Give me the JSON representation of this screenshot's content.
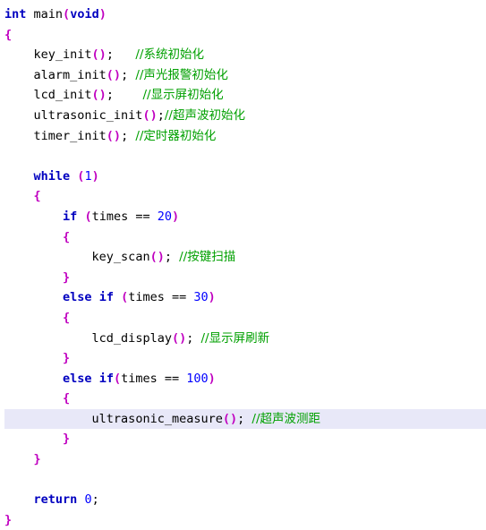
{
  "document": {
    "kind": "source-code-listing",
    "language": "c",
    "highlighted_line_index": 20,
    "lines": [
      {
        "id": "l1",
        "tokens": [
          {
            "t": "int",
            "c": "type"
          },
          {
            "t": " ",
            "c": "plain"
          },
          {
            "t": "main",
            "c": "fn"
          },
          {
            "t": "(",
            "c": "punc"
          },
          {
            "t": "void",
            "c": "type"
          },
          {
            "t": ")",
            "c": "punc"
          }
        ]
      },
      {
        "id": "l2",
        "tokens": [
          {
            "t": "{",
            "c": "punc"
          }
        ]
      },
      {
        "id": "l3",
        "tokens": [
          {
            "t": "    ",
            "c": "plain"
          },
          {
            "t": "key_init",
            "c": "fn"
          },
          {
            "t": "()",
            "c": "punc"
          },
          {
            "t": ";",
            "c": "plain"
          },
          {
            "t": "   ",
            "c": "plain"
          },
          {
            "t": "//系统初始化",
            "c": "cmt"
          }
        ]
      },
      {
        "id": "l4",
        "tokens": [
          {
            "t": "    ",
            "c": "plain"
          },
          {
            "t": "alarm_init",
            "c": "fn"
          },
          {
            "t": "()",
            "c": "punc"
          },
          {
            "t": "; ",
            "c": "plain"
          },
          {
            "t": "//声光报警初始化",
            "c": "cmt"
          }
        ]
      },
      {
        "id": "l5",
        "tokens": [
          {
            "t": "    ",
            "c": "plain"
          },
          {
            "t": "lcd_init",
            "c": "fn"
          },
          {
            "t": "()",
            "c": "punc"
          },
          {
            "t": ";",
            "c": "plain"
          },
          {
            "t": "    ",
            "c": "plain"
          },
          {
            "t": "//显示屏初始化",
            "c": "cmt"
          }
        ]
      },
      {
        "id": "l6",
        "tokens": [
          {
            "t": "    ",
            "c": "plain"
          },
          {
            "t": "ultrasonic_init",
            "c": "fn"
          },
          {
            "t": "()",
            "c": "punc"
          },
          {
            "t": ";",
            "c": "plain"
          },
          {
            "t": "//超声波初始化",
            "c": "cmt"
          }
        ]
      },
      {
        "id": "l7",
        "tokens": [
          {
            "t": "    ",
            "c": "plain"
          },
          {
            "t": "timer_init",
            "c": "fn"
          },
          {
            "t": "()",
            "c": "punc"
          },
          {
            "t": "; ",
            "c": "plain"
          },
          {
            "t": "//定时器初始化",
            "c": "cmt"
          }
        ]
      },
      {
        "id": "l8",
        "tokens": []
      },
      {
        "id": "l9",
        "tokens": [
          {
            "t": "    ",
            "c": "plain"
          },
          {
            "t": "while",
            "c": "kw"
          },
          {
            "t": " ",
            "c": "plain"
          },
          {
            "t": "(",
            "c": "punc"
          },
          {
            "t": "1",
            "c": "num"
          },
          {
            "t": ")",
            "c": "punc"
          }
        ]
      },
      {
        "id": "l10",
        "tokens": [
          {
            "t": "    ",
            "c": "plain"
          },
          {
            "t": "{",
            "c": "punc"
          }
        ]
      },
      {
        "id": "l11",
        "tokens": [
          {
            "t": "        ",
            "c": "plain"
          },
          {
            "t": "if",
            "c": "kw"
          },
          {
            "t": " ",
            "c": "plain"
          },
          {
            "t": "(",
            "c": "punc"
          },
          {
            "t": "times == ",
            "c": "plain"
          },
          {
            "t": "20",
            "c": "num"
          },
          {
            "t": ")",
            "c": "punc"
          }
        ]
      },
      {
        "id": "l12",
        "tokens": [
          {
            "t": "        ",
            "c": "plain"
          },
          {
            "t": "{",
            "c": "punc"
          }
        ]
      },
      {
        "id": "l13",
        "tokens": [
          {
            "t": "            ",
            "c": "plain"
          },
          {
            "t": "key_scan",
            "c": "fn"
          },
          {
            "t": "()",
            "c": "punc"
          },
          {
            "t": "; ",
            "c": "plain"
          },
          {
            "t": "//按键扫描",
            "c": "cmt"
          }
        ]
      },
      {
        "id": "l14",
        "tokens": [
          {
            "t": "        ",
            "c": "plain"
          },
          {
            "t": "}",
            "c": "punc"
          }
        ]
      },
      {
        "id": "l15",
        "tokens": [
          {
            "t": "        ",
            "c": "plain"
          },
          {
            "t": "else",
            "c": "kw"
          },
          {
            "t": " ",
            "c": "plain"
          },
          {
            "t": "if",
            "c": "kw"
          },
          {
            "t": " ",
            "c": "plain"
          },
          {
            "t": "(",
            "c": "punc"
          },
          {
            "t": "times == ",
            "c": "plain"
          },
          {
            "t": "30",
            "c": "num"
          },
          {
            "t": ")",
            "c": "punc"
          }
        ]
      },
      {
        "id": "l16",
        "tokens": [
          {
            "t": "        ",
            "c": "plain"
          },
          {
            "t": "{",
            "c": "punc"
          }
        ]
      },
      {
        "id": "l17",
        "tokens": [
          {
            "t": "            ",
            "c": "plain"
          },
          {
            "t": "lcd_display",
            "c": "fn"
          },
          {
            "t": "()",
            "c": "punc"
          },
          {
            "t": "; ",
            "c": "plain"
          },
          {
            "t": "//显示屏刷新",
            "c": "cmt"
          }
        ]
      },
      {
        "id": "l18",
        "tokens": [
          {
            "t": "        ",
            "c": "plain"
          },
          {
            "t": "}",
            "c": "punc"
          }
        ]
      },
      {
        "id": "l19",
        "tokens": [
          {
            "t": "        ",
            "c": "plain"
          },
          {
            "t": "else",
            "c": "kw"
          },
          {
            "t": " ",
            "c": "plain"
          },
          {
            "t": "if",
            "c": "kw"
          },
          {
            "t": "(",
            "c": "punc"
          },
          {
            "t": "times == ",
            "c": "plain"
          },
          {
            "t": "100",
            "c": "num"
          },
          {
            "t": ")",
            "c": "punc"
          }
        ]
      },
      {
        "id": "l20",
        "tokens": [
          {
            "t": "        ",
            "c": "plain"
          },
          {
            "t": "{",
            "c": "punc"
          }
        ]
      },
      {
        "id": "l21",
        "tokens": [
          {
            "t": "            ",
            "c": "plain"
          },
          {
            "t": "ultrasonic_measure",
            "c": "fn"
          },
          {
            "t": "()",
            "c": "punc"
          },
          {
            "t": "; ",
            "c": "plain"
          },
          {
            "t": "//超声波测距",
            "c": "cmt"
          }
        ]
      },
      {
        "id": "l22",
        "tokens": [
          {
            "t": "        ",
            "c": "plain"
          },
          {
            "t": "}",
            "c": "punc"
          }
        ]
      },
      {
        "id": "l23",
        "tokens": [
          {
            "t": "    ",
            "c": "plain"
          },
          {
            "t": "}",
            "c": "punc"
          }
        ]
      },
      {
        "id": "l24",
        "tokens": []
      },
      {
        "id": "l25",
        "tokens": [
          {
            "t": "    ",
            "c": "plain"
          },
          {
            "t": "return",
            "c": "kw"
          },
          {
            "t": " ",
            "c": "plain"
          },
          {
            "t": "0",
            "c": "num"
          },
          {
            "t": ";",
            "c": "plain"
          }
        ]
      },
      {
        "id": "l26",
        "tokens": [
          {
            "t": "}",
            "c": "punc"
          }
        ]
      }
    ]
  },
  "colors": {
    "keyword": "#0000c0",
    "punctuation": "#c000c0",
    "comment": "#00a000",
    "number": "#0000ff",
    "plain": "#000000",
    "background": "#ffffff",
    "highlight_row": "#e8e8f8"
  }
}
